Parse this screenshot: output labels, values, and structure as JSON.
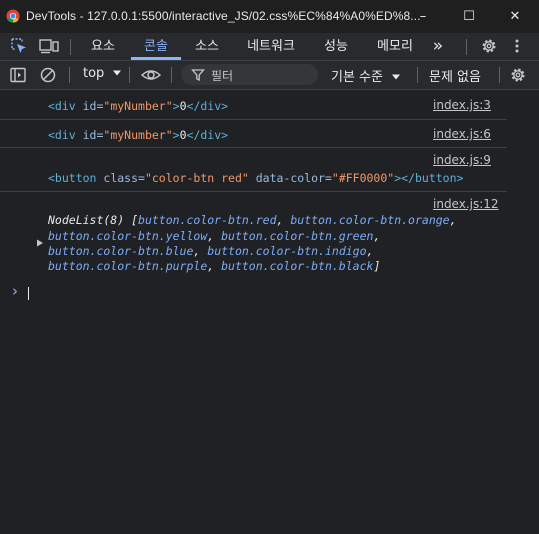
{
  "window": {
    "title": "DevTools - 127.0.0.1:5500/interactive_JS/02.css%EC%84%A0%ED%8...",
    "minimize_glyph": "–",
    "maximize_glyph": "☐",
    "close_glyph": "✕"
  },
  "tabs": {
    "items": [
      "요소",
      "콘솔",
      "소스",
      "네트워크",
      "성능",
      "메모리"
    ],
    "active": "콘솔",
    "more_glyph": "»"
  },
  "toolbar": {
    "context": "top",
    "filter_placeholder": "필터",
    "levels": "기본 수준",
    "issues": "문제 없음"
  },
  "console": {
    "messages": [
      {
        "source": "index.js:3",
        "tag_open": "<div",
        "attr_name": " id=",
        "attr_value": "\"myNumber\"",
        "close": ">",
        "text": "0",
        "tag_close": "</div>"
      },
      {
        "source": "index.js:6",
        "tag_open": "<div",
        "attr_name": " id=",
        "attr_value": "\"myNumber\"",
        "close": ">",
        "text": "0",
        "tag_close": "</div>"
      },
      {
        "source": "index.js:9",
        "tag_open": "<button",
        "attr1_name": " class=",
        "attr1_value": "\"color-btn red\"",
        "attr2_name": " data-color=",
        "attr2_value": "\"#FF0000\"",
        "close": ">",
        "tag_close": "</button>"
      },
      {
        "source": "index.js:12",
        "nodelist_label": "NodeList(8) [",
        "items": [
          "button.color-btn.red",
          "button.color-btn.orange",
          "button.color-btn.yellow",
          "button.color-btn.green",
          "button.color-btn.blue",
          "button.color-btn.indigo",
          "button.color-btn.purple",
          "button.color-btn.black"
        ],
        "nodelist_close": "]"
      }
    ],
    "prompt_glyph": "›"
  },
  "colors": {
    "accent": "#8ab4f8",
    "background": "#202124",
    "toolbar": "#292a2d",
    "tag": "#5db0d7",
    "attr": "#9bbbdc",
    "value": "#f29766"
  }
}
